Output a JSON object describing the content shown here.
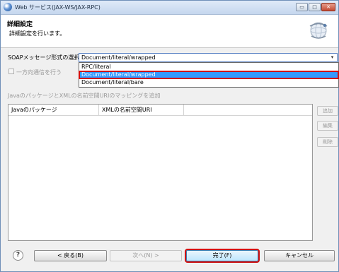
{
  "window": {
    "title": "Web サービス(JAX-WS/JAX-RPC)",
    "controls": {
      "minimize": "▭",
      "maximize": "□",
      "close": "✕"
    }
  },
  "header": {
    "title": "詳細設定",
    "description": "詳細設定を行います。"
  },
  "soap": {
    "label": "SOAPメッセージ形式の選択",
    "selected": "Document/literal/wrapped",
    "options": [
      "RPC/literal",
      "Document/literal/wrapped",
      "Document/literal/bare"
    ],
    "highlighted_index": 1
  },
  "oneway": {
    "label": "一方向通信を行う",
    "checked": false
  },
  "mapping": {
    "label": "JavaのパッケージとXMLの名前空間URIのマッピングを追加",
    "columns": [
      "Javaのパッケージ",
      "XMLの名前空間URI",
      ""
    ],
    "rows": []
  },
  "side_buttons": {
    "add": "追加",
    "edit": "編集",
    "delete": "削除"
  },
  "footer": {
    "help": "?",
    "back": "< 戻る(B)",
    "next": "次へ(N) >",
    "finish": "完了(F)",
    "cancel": "キャンセル"
  }
}
